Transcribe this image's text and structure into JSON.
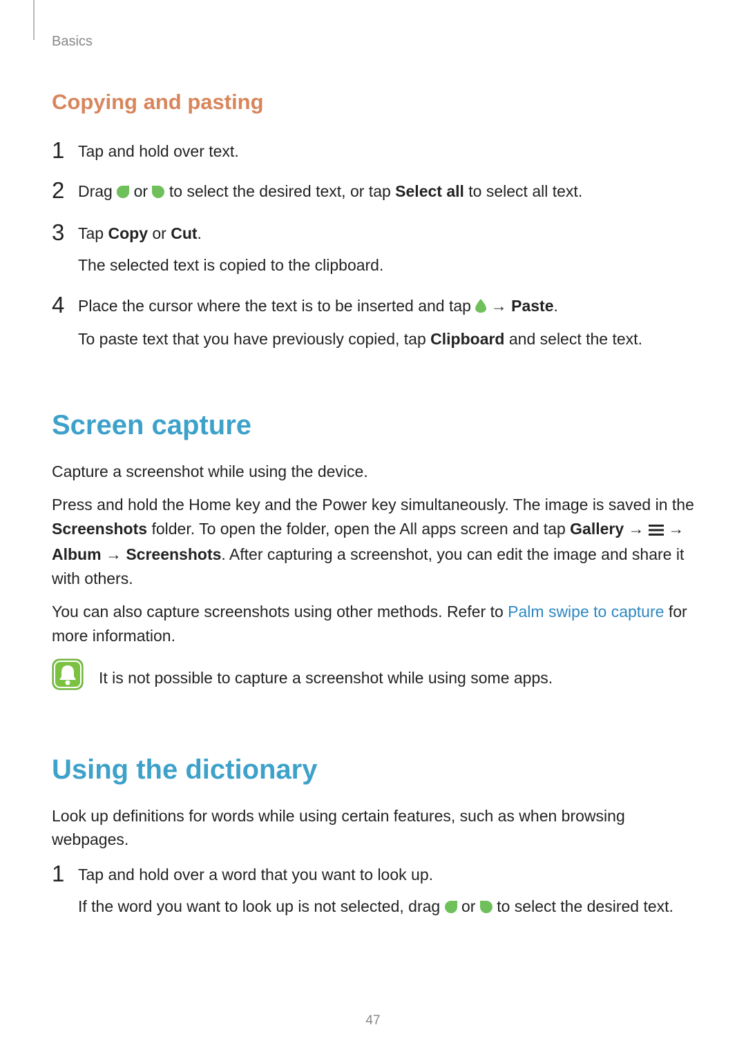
{
  "header": {
    "breadcrumb": "Basics"
  },
  "sections": {
    "copying": {
      "title": "Copying and pasting",
      "steps": {
        "n1": "1",
        "s1": "Tap and hold over text.",
        "n2": "2",
        "s2a": "Drag ",
        "s2b": " or ",
        "s2c": " to select the desired text, or tap ",
        "s2d": "Select all",
        "s2e": " to select all text.",
        "n3": "3",
        "s3a": "Tap ",
        "s3b": "Copy",
        "s3c": " or ",
        "s3d": "Cut",
        "s3e": ".",
        "s3sub": "The selected text is copied to the clipboard.",
        "n4": "4",
        "s4a": "Place the cursor where the text is to be inserted and tap ",
        "s4b": " → ",
        "s4c": "Paste",
        "s4d": ".",
        "s4sub_a": "To paste text that you have previously copied, tap ",
        "s4sub_b": "Clipboard",
        "s4sub_c": " and select the text."
      }
    },
    "capture": {
      "title": "Screen capture",
      "p1": "Capture a screenshot while using the device.",
      "p2a": "Press and hold the Home key and the Power key simultaneously. The image is saved in the ",
      "p2b": "Screenshots",
      "p2c": " folder. To open the folder, open the All apps screen and tap ",
      "p2d": "Gallery",
      "p2e": " → ",
      "p2f": " → ",
      "p2g": "Album",
      "p2h": " → ",
      "p2i": "Screenshots",
      "p2j": ". After capturing a screenshot, you can edit the image and share it with others.",
      "p3a": "You can also capture screenshots using other methods. Refer to ",
      "p3link": "Palm swipe to capture",
      "p3b": " for more information.",
      "note": "It is not possible to capture a screenshot while using some apps."
    },
    "dictionary": {
      "title": "Using the dictionary",
      "p1": "Look up definitions for words while using certain features, such as when browsing webpages.",
      "n1": "1",
      "s1": "Tap and hold over a word that you want to look up.",
      "s1sub_a": "If the word you want to look up is not selected, drag ",
      "s1sub_b": " or ",
      "s1sub_c": " to select the desired text."
    }
  },
  "icons": {
    "handle_left": "selection-handle-left-icon",
    "handle_right": "selection-handle-right-icon",
    "cursor": "cursor-drop-icon",
    "menu": "menu-icon",
    "bell": "notice-bell-icon"
  },
  "page_number": "47"
}
